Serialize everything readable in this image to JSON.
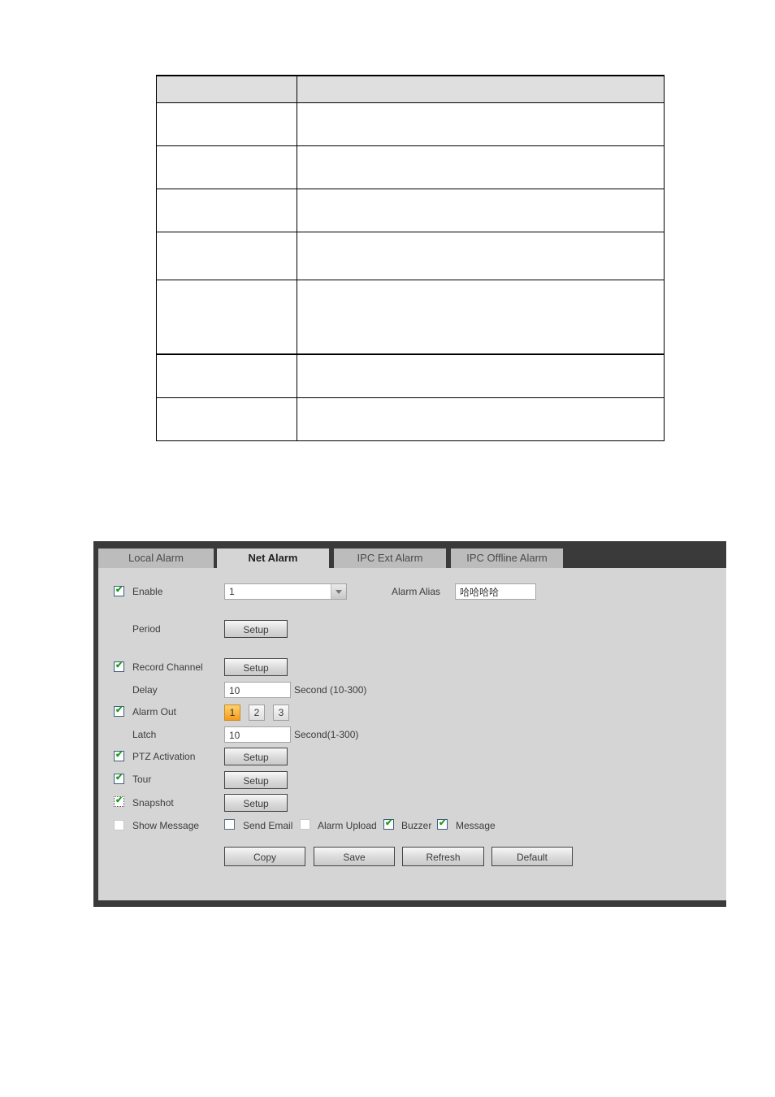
{
  "doc_table": {
    "rows": [
      {
        "kind": "header",
        "cells": [
          "",
          ""
        ]
      },
      {
        "kind": "row",
        "cells": [
          "",
          ""
        ]
      },
      {
        "kind": "row",
        "cells": [
          "",
          ""
        ]
      },
      {
        "kind": "row",
        "cells": [
          "",
          ""
        ]
      },
      {
        "kind": "row",
        "cells": [
          "",
          ""
        ]
      },
      {
        "kind": "row",
        "cells": [
          "",
          ""
        ]
      },
      {
        "kind": "row",
        "cells": [
          "",
          ""
        ]
      },
      {
        "kind": "row",
        "cells": [
          "",
          ""
        ]
      }
    ]
  },
  "panel": {
    "tabs": [
      {
        "label": "Local Alarm",
        "active": false
      },
      {
        "label": "Net Alarm",
        "active": true
      },
      {
        "label": "IPC Ext Alarm",
        "active": false
      },
      {
        "label": "IPC Offline Alarm",
        "active": false
      }
    ],
    "enable": {
      "label": "Enable",
      "checked": true,
      "channel_value": "1"
    },
    "alarm_alias": {
      "label": "Alarm Alias",
      "value": "哈哈哈哈"
    },
    "period": {
      "label": "Period",
      "button": "Setup"
    },
    "record_channel": {
      "label": "Record Channel",
      "checked": true,
      "button": "Setup"
    },
    "delay": {
      "label": "Delay",
      "value": "10",
      "unit": "Second (10-300)"
    },
    "alarm_out": {
      "label": "Alarm Out",
      "checked": true,
      "outputs": [
        "1",
        "2",
        "3"
      ],
      "active_output": "1"
    },
    "latch": {
      "label": "Latch",
      "value": "10",
      "unit": "Second(1-300)"
    },
    "ptz_activation": {
      "label": "PTZ Activation",
      "checked": true,
      "button": "Setup"
    },
    "tour": {
      "label": "Tour",
      "checked": true,
      "button": "Setup"
    },
    "snapshot": {
      "label": "Snapshot",
      "checked": true,
      "button": "Setup"
    },
    "show_message": {
      "label": "Show Message",
      "checked": false
    },
    "send_email": {
      "label": "Send Email",
      "checked": false
    },
    "alarm_upload": {
      "label": "Alarm Upload",
      "checked": false
    },
    "buzzer": {
      "label": "Buzzer",
      "checked": true
    },
    "message": {
      "label": "Message",
      "checked": true
    },
    "actions": {
      "copy": "Copy",
      "save": "Save",
      "refresh": "Refresh",
      "default": "Default"
    },
    "check_glyph": "✔"
  }
}
